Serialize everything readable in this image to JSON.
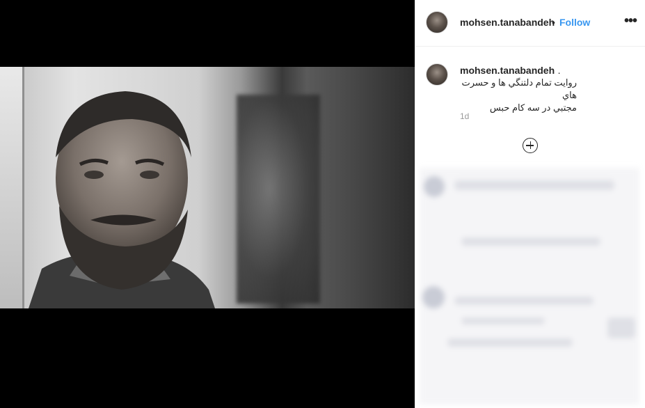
{
  "post": {
    "username": "mohsen.tanabandeh",
    "separator": "•",
    "follow_label": "Follow",
    "more_label": "•••"
  },
  "caption": {
    "username": "mohsen.tanabandeh",
    "suffix": ".",
    "text_line1": "روایت تمام دلتنگي ها و حسرت هاي",
    "text_line2": "مجتبي در سه کام حبس",
    "time_ago": "1d"
  },
  "icons": {
    "more": "more-options-icon",
    "load_more": "plus-circle-icon"
  },
  "colors": {
    "follow": "#3897f0",
    "text": "#262626",
    "muted": "#999999",
    "media_bg": "#000000"
  }
}
